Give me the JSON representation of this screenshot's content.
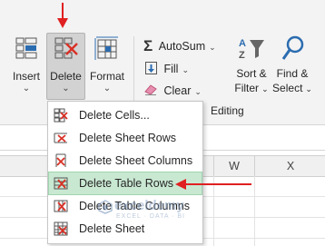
{
  "ribbon": {
    "insert": {
      "label": "Insert",
      "chev": "⌄"
    },
    "delete": {
      "label": "Delete",
      "chev": "⌄"
    },
    "format": {
      "label": "Format",
      "chev": "⌄"
    },
    "autosum": {
      "label": "AutoSum",
      "chev": "⌄"
    },
    "fill": {
      "label": "Fill",
      "chev": "⌄"
    },
    "clear": {
      "label": "Clear",
      "chev": "⌄"
    },
    "sort_filter": {
      "line1": "Sort &",
      "line2": "Filter",
      "chev": "⌄"
    },
    "find_select": {
      "line1": "Find &",
      "line2": "Select",
      "chev": "⌄"
    },
    "group_label": "Editing"
  },
  "column_headers": [
    "W",
    "X"
  ],
  "delete_menu": {
    "items": [
      {
        "label": "Delete Cells...",
        "icon": "delete-cells-icon"
      },
      {
        "label": "Delete Sheet Rows",
        "icon": "delete-rows-icon"
      },
      {
        "label": "Delete Sheet Columns",
        "icon": "delete-columns-icon"
      },
      {
        "label": "Delete Table Rows",
        "icon": "delete-table-rows-icon",
        "highlighted": true
      },
      {
        "label": "Delete Table Columns",
        "icon": "delete-table-columns-icon"
      },
      {
        "label": "Delete Sheet",
        "icon": "delete-sheet-icon"
      }
    ]
  },
  "watermark": {
    "brand": "exceldemy",
    "tagline": "EXCEL · DATA · BI"
  },
  "colors": {
    "accent_red": "#e02020",
    "highlight": "#c9e8d2",
    "icon_blue": "#2b6cb0"
  }
}
